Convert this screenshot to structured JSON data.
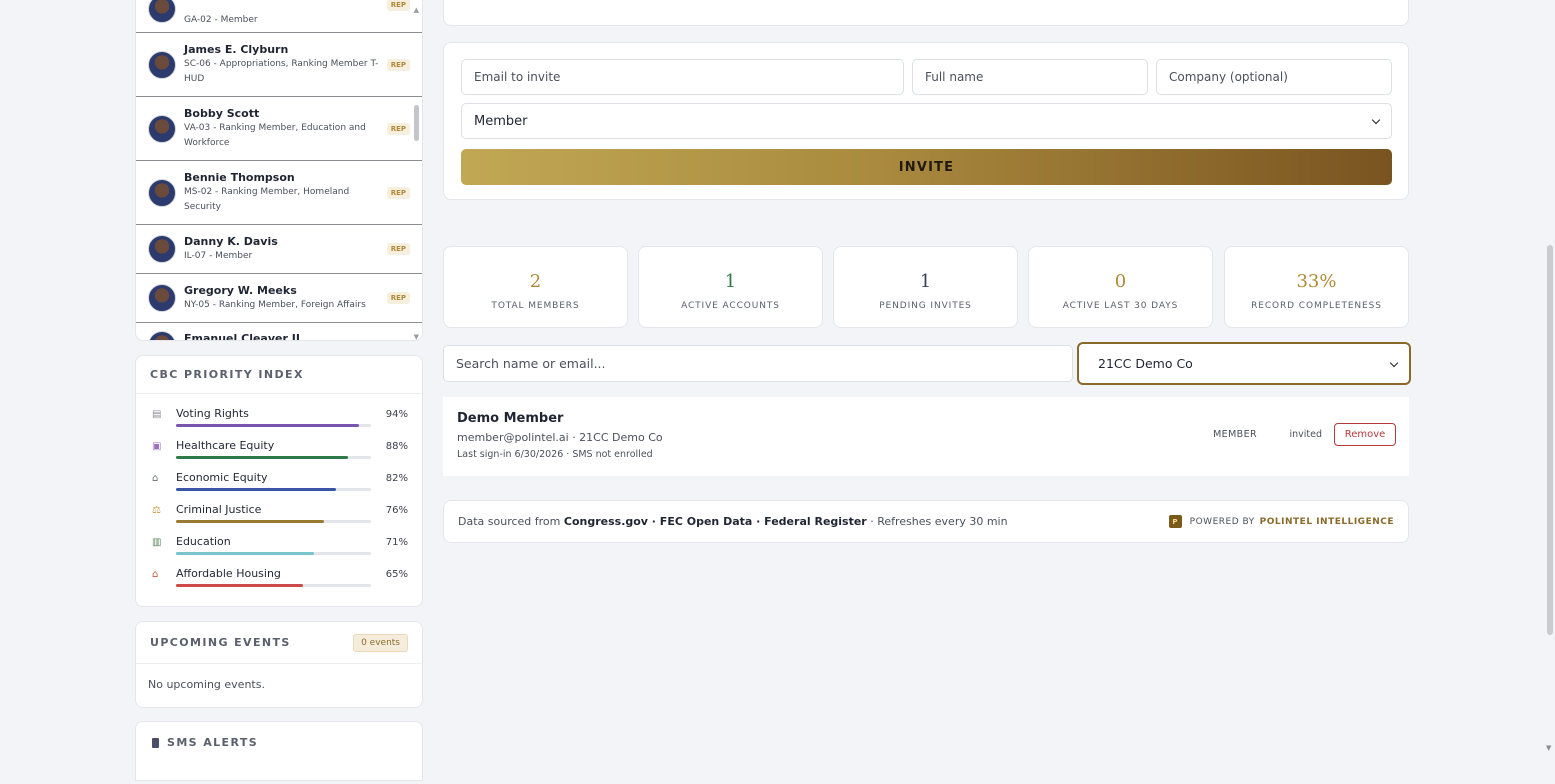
{
  "members": [
    {
      "name": "",
      "sub": "GA-02 - Member",
      "badge": "REP"
    },
    {
      "name": "James E. Clyburn",
      "sub": "SC-06 - Appropriations, Ranking Member T-HUD",
      "badge": "REP"
    },
    {
      "name": "Bobby Scott",
      "sub": "VA-03 - Ranking Member, Education and Workforce",
      "badge": "REP"
    },
    {
      "name": "Bennie Thompson",
      "sub": "MS-02 - Ranking Member, Homeland Security",
      "badge": "REP"
    },
    {
      "name": "Danny K. Davis",
      "sub": "IL-07 - Member",
      "badge": "REP"
    },
    {
      "name": "Gregory W. Meeks",
      "sub": "NY-05 - Ranking Member, Foreign Affairs",
      "badge": "REP"
    },
    {
      "name": "Emanuel Cleaver II",
      "sub": "",
      "badge": ""
    }
  ],
  "priority": {
    "title": "CBC PRIORITY INDEX",
    "items": [
      {
        "label": "Voting Rights",
        "pct": "94%",
        "value": 0.94,
        "color": "#7a55b0",
        "icon": "ballot-icon"
      },
      {
        "label": "Healthcare Equity",
        "pct": "88%",
        "value": 0.88,
        "color": "#2f7a4a",
        "icon": "hospital-icon"
      },
      {
        "label": "Economic Equity",
        "pct": "82%",
        "value": 0.82,
        "color": "#3a55a8",
        "icon": "bank-icon"
      },
      {
        "label": "Criminal Justice",
        "pct": "76%",
        "value": 0.76,
        "color": "#9a7a32",
        "icon": "scales-icon"
      },
      {
        "label": "Education",
        "pct": "71%",
        "value": 0.71,
        "color": "#7ac4cc",
        "icon": "books-icon"
      },
      {
        "label": "Affordable Housing",
        "pct": "65%",
        "value": 0.65,
        "color": "#cc4a4a",
        "icon": "house-icon"
      }
    ]
  },
  "events": {
    "title": "UPCOMING EVENTS",
    "badge": "0 events",
    "empty": "No upcoming events."
  },
  "sms": {
    "title": "SMS ALERTS"
  },
  "invite": {
    "email_placeholder": "Email to invite",
    "name_placeholder": "Full name",
    "company_placeholder": "Company (optional)",
    "role_value": "Member",
    "button_label": "INVITE"
  },
  "stats": [
    {
      "value": "2",
      "label": "TOTAL MEMBERS",
      "color": "#b08a3a"
    },
    {
      "value": "1",
      "label": "ACTIVE ACCOUNTS",
      "color": "#2f7a4a"
    },
    {
      "value": "1",
      "label": "PENDING INVITES",
      "color": "#3a3f5a"
    },
    {
      "value": "0",
      "label": "ACTIVE LAST 30 DAYS",
      "color": "#b08a3a"
    },
    {
      "value": "33%",
      "label": "RECORD COMPLETENESS",
      "color": "#b08a3a"
    }
  ],
  "filter": {
    "search_placeholder": "Search name or email...",
    "company_value": "21CC Demo Co"
  },
  "member_card": {
    "name": "Demo Member",
    "email": "member@polintel.ai · 21CC Demo Co",
    "signin": "Last sign-in 6/30/2026 · SMS not enrolled",
    "role": "MEMBER",
    "status": "invited",
    "remove_label": "Remove"
  },
  "footer": {
    "prefix": "Data sourced from",
    "sources": "Congress.gov · FEC Open Data · Federal Register",
    "refresh": "· Refreshes every 30 min",
    "logo_letter": "P",
    "powered": "POWERED BY",
    "brand": "POLINTEL INTELLIGENCE"
  }
}
